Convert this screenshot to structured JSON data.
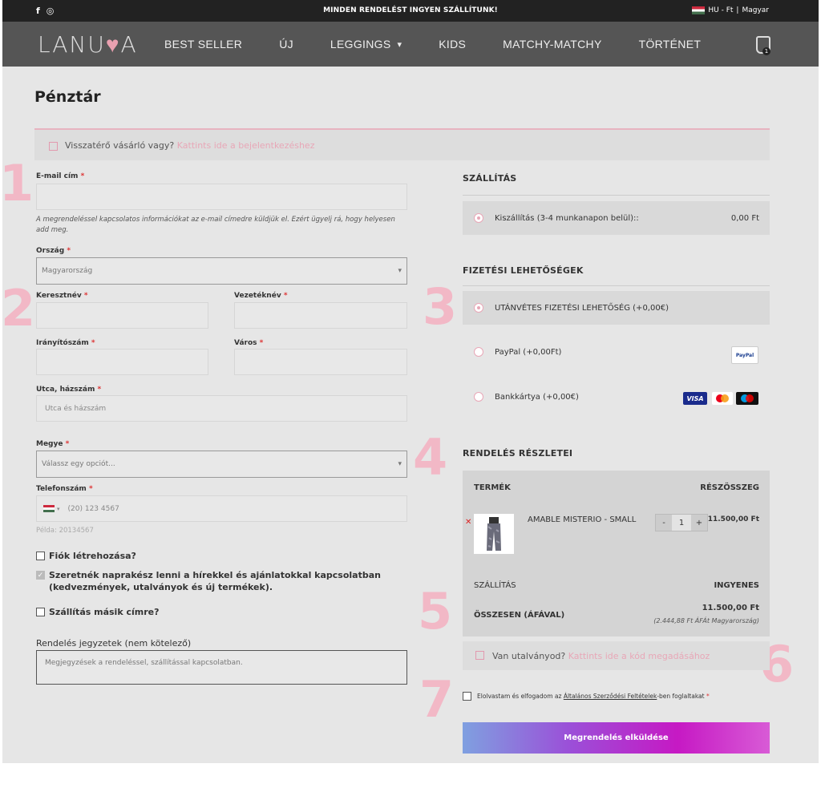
{
  "topbar": {
    "facebook_glyph": "f",
    "instagram_glyph": "◎",
    "promo": "MINDEN RENDELÉST INGYEN SZÁLLÍTUNK!",
    "lang": "HU - Ft",
    "sep": "|",
    "lang_name": "Magyar"
  },
  "nav": {
    "logo_a": "LANU",
    "logo_heart": "♥",
    "logo_b": "A",
    "items": [
      "BEST SELLER",
      "ÚJ",
      "LEGGINGS",
      "KIDS",
      "MATCHY-MATCHY",
      "TÖRTÉNET"
    ],
    "leggings_caret": "▾",
    "cart_count": "1"
  },
  "page": {
    "title": "Pénztár",
    "returning": "Visszatérő vásárló vagy?",
    "returning_link": "Kattints ide a bejelentkezéshez"
  },
  "steps": [
    "1",
    "2",
    "3",
    "4",
    "5",
    "6",
    "7"
  ],
  "form": {
    "req": "*",
    "email_label": "E-mail cím",
    "email_hint": "A megrendeléssel kapcsolatos információkat az e-mail címedre küldjük el. Ezért ügyelj rá, hogy helyesen add meg.",
    "country_label": "Ország",
    "country_value": "Magyarország",
    "first_name_label": "Keresztnév",
    "last_name_label": "Vezetéknév",
    "zip_label": "Irányítószám",
    "city_label": "Város",
    "street_label": "Utca, házszám",
    "street_placeholder": "Utca és házszám",
    "county_label": "Megye",
    "county_placeholder": "Válassz egy opciót...",
    "phone_label": "Telefonszám",
    "phone_caret": "▾",
    "phone_placeholder": "(20) 123 4567",
    "phone_example": "Példa: 20134567",
    "create_account": "Fiók létrehozása?",
    "newsletter": "Szeretnék naprakész lenni a hírekkel és ajánlatokkal kapcsolatban (kedvezmények, utalványok és új termékek).",
    "newsletter_check": "✓",
    "ship_other": "Szállítás másik címre?",
    "notes_label": "Rendelés jegyzetek (nem kötelező)",
    "notes_placeholder": "Megjegyzések a rendeléssel, szállítással kapcsolatban."
  },
  "shipping": {
    "heading": "SZÁLLÍTÁS",
    "option": "Kiszállítás (3-4 munkanapon belül)::",
    "price": "0,00 Ft"
  },
  "payment": {
    "heading": "FIZETÉSI LEHETŐSÉGEK",
    "options": [
      "UTÁNVÉTES FIZETÉSI LEHETŐSÉG (+0,00€)",
      "PayPal (+0,00Ft)",
      "Bankkártya (+0,00€)"
    ],
    "paypal_badge": "PayPal",
    "visa": "VISA"
  },
  "order": {
    "heading": "RENDELÉS RÉSZLETEI",
    "col_product": "TERMÉK",
    "col_subtotal": "RÉSZÖSSZEG",
    "remove": "✕",
    "product_name": "AMABLE MISTERIO - SMALL",
    "qty_minus": "-",
    "qty": "1",
    "qty_plus": "+",
    "product_price": "11.500,00 Ft",
    "shipping_label": "SZÁLLÍTÁS",
    "shipping_value": "INGYENES",
    "total_label": "ÖSSZESEN (ÁFÁVAL)",
    "total_value": "11.500,00 Ft",
    "tax_note": "(2.444,88 Ft ÁFÁt Magyarország)"
  },
  "voucher": {
    "text": "Van utalványod?",
    "link": "Kattints ide a kód megadásához"
  },
  "terms": {
    "pre": "Elolvastam és elfogadom az",
    "link": "Általános Szerződési Feltételek",
    "post": "-ben foglaltakat"
  },
  "submit_label": "Megrendelés elküldése"
}
